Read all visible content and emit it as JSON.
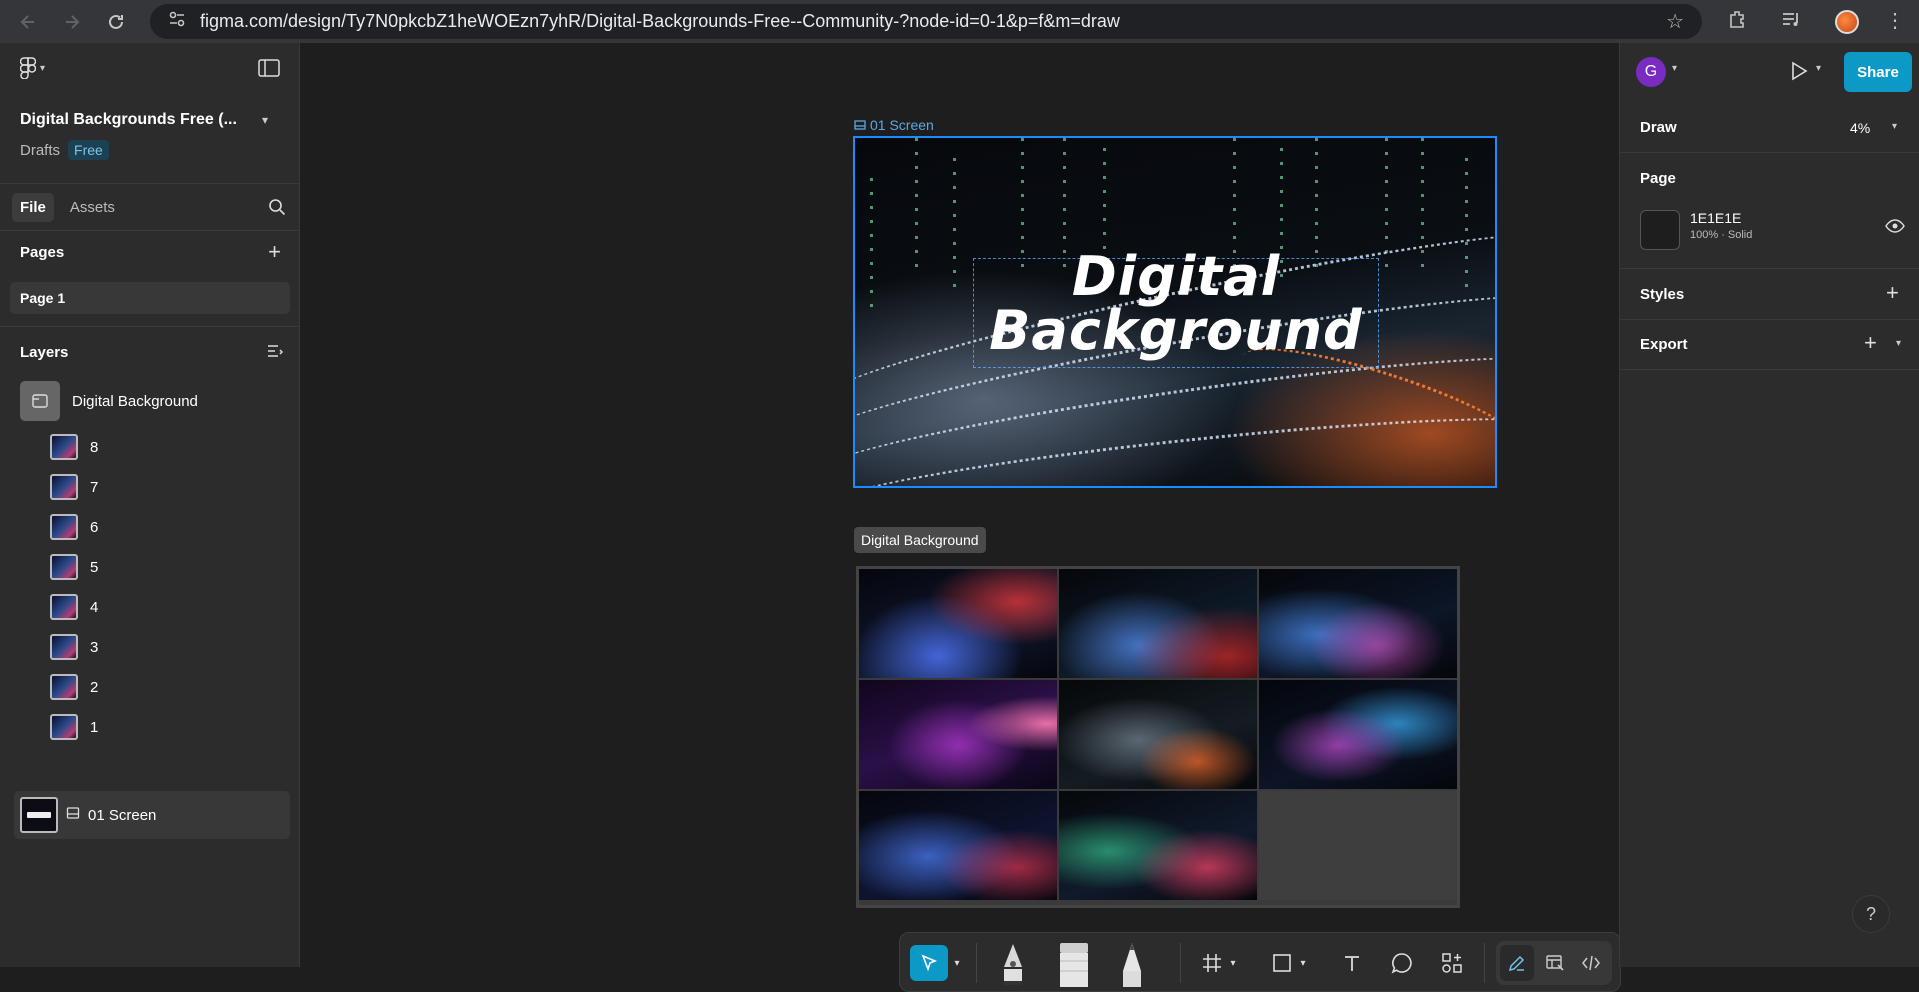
{
  "browser": {
    "url": "figma.com/design/Ty7N0pkcbZ1heWOEzn7yhR/Digital-Backgrounds-Free--Community-?node-id=0-1&p=f&m=draw"
  },
  "file": {
    "title": "Digital Backgrounds Free (...",
    "location": "Drafts",
    "plan_badge": "Free"
  },
  "left_tabs": [
    "File",
    "Assets"
  ],
  "pages": {
    "heading": "Pages",
    "items": [
      "Page 1"
    ]
  },
  "layers": {
    "heading": "Layers",
    "group": "Digital Background",
    "children": [
      "8",
      "7",
      "6",
      "5",
      "4",
      "3",
      "2",
      "1"
    ],
    "screen": "01 Screen"
  },
  "canvas": {
    "frame1_label": "01 Screen",
    "hero_line1": "Digital",
    "hero_line2": "Background",
    "frame2_label": "Digital Background"
  },
  "right_panel": {
    "avatar_letter": "G",
    "share_label": "Share",
    "mode": "Draw",
    "zoom": "4%",
    "page_heading": "Page",
    "page_fill_hex": "1E1E1E",
    "page_fill_meta": "100% · Solid",
    "styles_heading": "Styles",
    "export_heading": "Export"
  },
  "colors": {
    "accent": "#0d99c6",
    "selection": "#1a8cff",
    "panel": "#2c2c2c",
    "canvas": "#1e1e1e"
  },
  "help_label": "?"
}
